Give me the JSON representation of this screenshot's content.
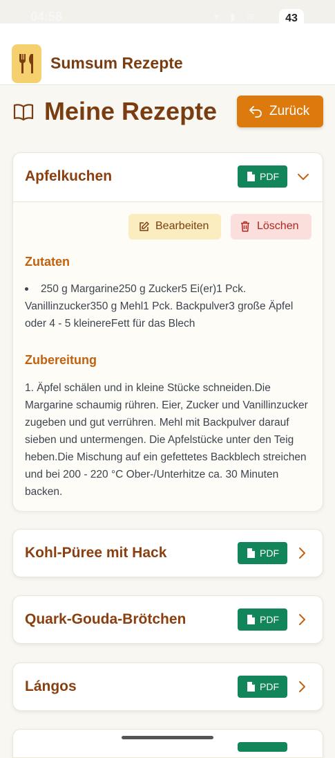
{
  "status_bar": {
    "time": "04:58",
    "signal": "▾ ▮ ≋",
    "battery": "43"
  },
  "app": {
    "title": "Sumsum Rezepte",
    "logo_icon": "fork-knife-icon"
  },
  "header": {
    "title": "Meine Rezepte",
    "title_icon": "book-open-icon",
    "back_label": "Zurück",
    "back_icon": "undo-arrow-icon"
  },
  "colors": {
    "accent": "#dd7a0d",
    "brand": "#7a3d12",
    "pdf": "#12855a",
    "background": "#f9f7f1"
  },
  "recipes": [
    {
      "title": "Apfelkuchen",
      "pdf_label": "PDF",
      "expanded": true,
      "edit_label": "Bearbeiten",
      "delete_label": "Löschen",
      "ingredients_heading": "Zutaten",
      "ingredients": [
        "250 g Margarine250 g Zucker5 Ei(er)1 Pck. Vanillinzucker350 g Mehl1 Pck. Backpulver3 große Äpfel oder 4 - 5 kleinereFett für das Blech"
      ],
      "preparation_heading": "Zubereitung",
      "preparation": "1. Äpfel schälen und in kleine Stücke schneiden.Die Margarine schaumig rühren. Eier, Zucker und Vanillinzucker zugeben und gut verrühren. Mehl mit Backpulver darauf sieben und untermengen. Die Apfelstücke unter den Teig heben.Die Mischung auf ein gefettetes Backblech streichen und bei 200 - 220 °C Ober-/Unterhitze ca. 30 Minuten backen."
    },
    {
      "title": "Kohl-Püree mit Hack",
      "pdf_label": "PDF",
      "expanded": false
    },
    {
      "title": "Quark-Gouda-Brötchen",
      "pdf_label": "PDF",
      "expanded": false
    },
    {
      "title": "Lángos",
      "pdf_label": "PDF",
      "expanded": false
    },
    {
      "title": "",
      "pdf_label": "",
      "expanded": false
    }
  ]
}
